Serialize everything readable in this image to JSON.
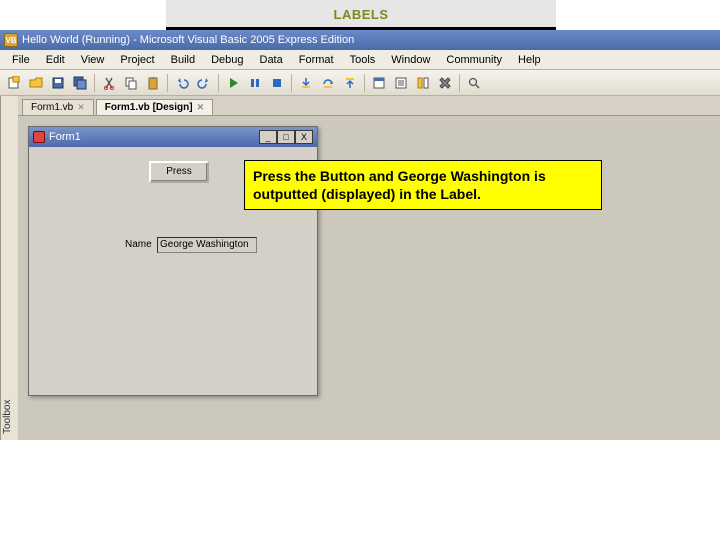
{
  "slide": {
    "header": "LABELS"
  },
  "vs": {
    "title": "Hello World (Running) - Microsoft Visual Basic 2005 Express Edition",
    "menu": [
      "File",
      "Edit",
      "View",
      "Project",
      "Build",
      "Debug",
      "Data",
      "Format",
      "Tools",
      "Window",
      "Community",
      "Help"
    ],
    "toolbox_label": "Toolbox"
  },
  "tabs": {
    "items": [
      {
        "label": "Form1.vb"
      },
      {
        "label": "Form1.vb [Design]"
      }
    ]
  },
  "form": {
    "title": "Form1",
    "button_label": "Press",
    "name_label": "Name",
    "name_value": "George Washington",
    "win": {
      "min": "_",
      "max": "□",
      "close": "X"
    }
  },
  "annotation": {
    "text": "Press the Button and George Washington is outputted (displayed) in the Label."
  }
}
